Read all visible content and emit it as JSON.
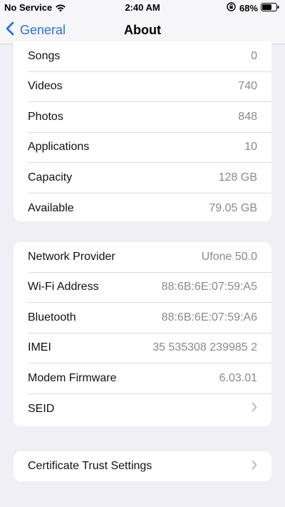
{
  "status_bar": {
    "carrier": "No Service",
    "time": "2:40 AM",
    "battery": "68%",
    "icons": [
      "wifi-icon",
      "orientation-lock-icon",
      "battery-icon"
    ]
  },
  "nav": {
    "back_label": "General",
    "title": "About"
  },
  "media_group": [
    {
      "label": "Songs",
      "value": "0"
    },
    {
      "label": "Videos",
      "value": "740"
    },
    {
      "label": "Photos",
      "value": "848"
    },
    {
      "label": "Applications",
      "value": "10"
    },
    {
      "label": "Capacity",
      "value": "128 GB"
    },
    {
      "label": "Available",
      "value": "79.05 GB"
    }
  ],
  "network_group": [
    {
      "label": "Network Provider",
      "value": "Ufone 50.0"
    },
    {
      "label": "Wi-Fi Address",
      "value": "88:6B:6E:07:59:A5"
    },
    {
      "label": "Bluetooth",
      "value": "88:6B:6E:07:59:A6"
    },
    {
      "label": "IMEI",
      "value": "35 535308 239985 2"
    },
    {
      "label": "Modem Firmware",
      "value": "6.03.01"
    },
    {
      "label": "SEID",
      "value": ""
    }
  ],
  "cert_group": {
    "label": "Certificate Trust Settings"
  },
  "colors": {
    "accent": "#2a72d9",
    "background": "#f0eff5",
    "secondary_text": "#8a8a8e"
  }
}
